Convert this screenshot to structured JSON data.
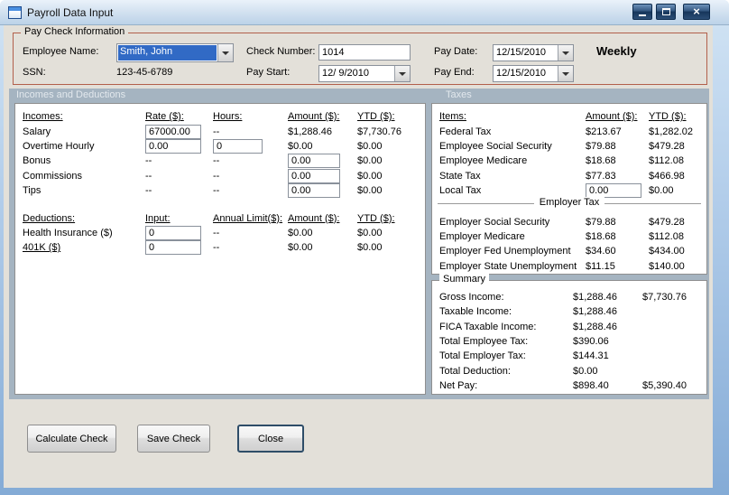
{
  "window": {
    "title": "Payroll Data Input",
    "controls": {
      "close_glyph": "×"
    }
  },
  "colors": {
    "selection_highlight": "#316ac5",
    "groupbox_border": "#b2604b",
    "band_background": "#a5b4c1"
  },
  "paycheck": {
    "legend": "Pay Check Information",
    "fields": {
      "employee_name": {
        "label": "Employee Name:",
        "value": "Smith, John"
      },
      "ssn": {
        "label": "SSN:",
        "value": "123-45-6789"
      },
      "check_number": {
        "label": "Check Number:",
        "value": "1014"
      },
      "pay_start": {
        "label": "Pay Start:",
        "value": "12/ 9/2010"
      },
      "pay_date": {
        "label": "Pay Date:",
        "value": "12/15/2010"
      },
      "pay_end": {
        "label": "Pay End:",
        "value": "12/15/2010"
      }
    },
    "frequency": "Weekly"
  },
  "section_headers": {
    "left": "Incomes and Deductions",
    "right": "Taxes"
  },
  "incomes": {
    "headers": {
      "c1": "Incomes:",
      "c2": "Rate ($):",
      "c3": "Hours:",
      "c4": "Amount ($):",
      "c5": "YTD ($):"
    },
    "rows": [
      {
        "label": "Salary",
        "rate": "67000.00",
        "hours": "--",
        "amount": "$1,288.46",
        "ytd": "$7,730.76"
      },
      {
        "label": "Overtime Hourly",
        "rate": "0.00",
        "hours": "0",
        "amount": "$0.00",
        "ytd": "$0.00"
      },
      {
        "label": "Bonus",
        "rate": "--",
        "hours": "--",
        "amount": "0.00",
        "ytd": "$0.00"
      },
      {
        "label": "Commissions",
        "rate": "--",
        "hours": "--",
        "amount": "0.00",
        "ytd": "$0.00"
      },
      {
        "label": "Tips",
        "rate": "--",
        "hours": "--",
        "amount": "0.00",
        "ytd": "$0.00"
      }
    ]
  },
  "deductions": {
    "headers": {
      "c1": "Deductions:",
      "c2": "Input:",
      "c3": "Annual Limit($):",
      "c4": "Amount ($):",
      "c5": "YTD ($):"
    },
    "rows": [
      {
        "label": "Health Insurance ($)",
        "input": "0",
        "limit": "--",
        "amount": "$0.00",
        "ytd": "$0.00"
      },
      {
        "label": "401K ($)",
        "input": "0",
        "limit": "--",
        "amount": "$0.00",
        "ytd": "$0.00"
      }
    ]
  },
  "taxes": {
    "headers": {
      "c1": "Items:",
      "c2": "Amount ($):",
      "c3": "YTD ($):"
    },
    "employee_rows": [
      {
        "label": "Federal Tax",
        "amount": "$213.67",
        "ytd": "$1,282.02"
      },
      {
        "label": "Employee Social Security",
        "amount": "$79.88",
        "ytd": "$479.28"
      },
      {
        "label": "Employee Medicare",
        "amount": "$18.68",
        "ytd": "$112.08"
      },
      {
        "label": "State Tax",
        "amount": "$77.83",
        "ytd": "$466.98"
      }
    ],
    "local_tax": {
      "label": "Local Tax",
      "input": "0.00",
      "ytd": "$0.00"
    },
    "employer_header": "Employer Tax",
    "employer_rows": [
      {
        "label": "Employer Social Security",
        "amount": "$79.88",
        "ytd": "$479.28"
      },
      {
        "label": "Employer Medicare",
        "amount": "$18.68",
        "ytd": "$112.08"
      },
      {
        "label": "Employer Fed Unemployment",
        "amount": "$34.60",
        "ytd": "$434.00"
      },
      {
        "label": "Employer State Unemployment",
        "amount": "$11.15",
        "ytd": "$140.00"
      }
    ]
  },
  "summary": {
    "legend": "Summary",
    "rows": [
      {
        "label": "Gross Income:",
        "amount": "$1,288.46",
        "ytd": "$7,730.76"
      },
      {
        "label": "Taxable Income:",
        "amount": "$1,288.46",
        "ytd": ""
      },
      {
        "label": "FICA Taxable Income:",
        "amount": "$1,288.46",
        "ytd": ""
      },
      {
        "label": "Total Employee Tax:",
        "amount": "$390.06",
        "ytd": ""
      },
      {
        "label": "Total Employer Tax:",
        "amount": "$144.31",
        "ytd": ""
      },
      {
        "label": "Total Deduction:",
        "amount": "$0.00",
        "ytd": ""
      },
      {
        "label": "Net Pay:",
        "amount": "$898.40",
        "ytd": "$5,390.40"
      }
    ]
  },
  "buttons": {
    "calculate": "Calculate Check",
    "save": "Save Check",
    "close": "Close"
  }
}
